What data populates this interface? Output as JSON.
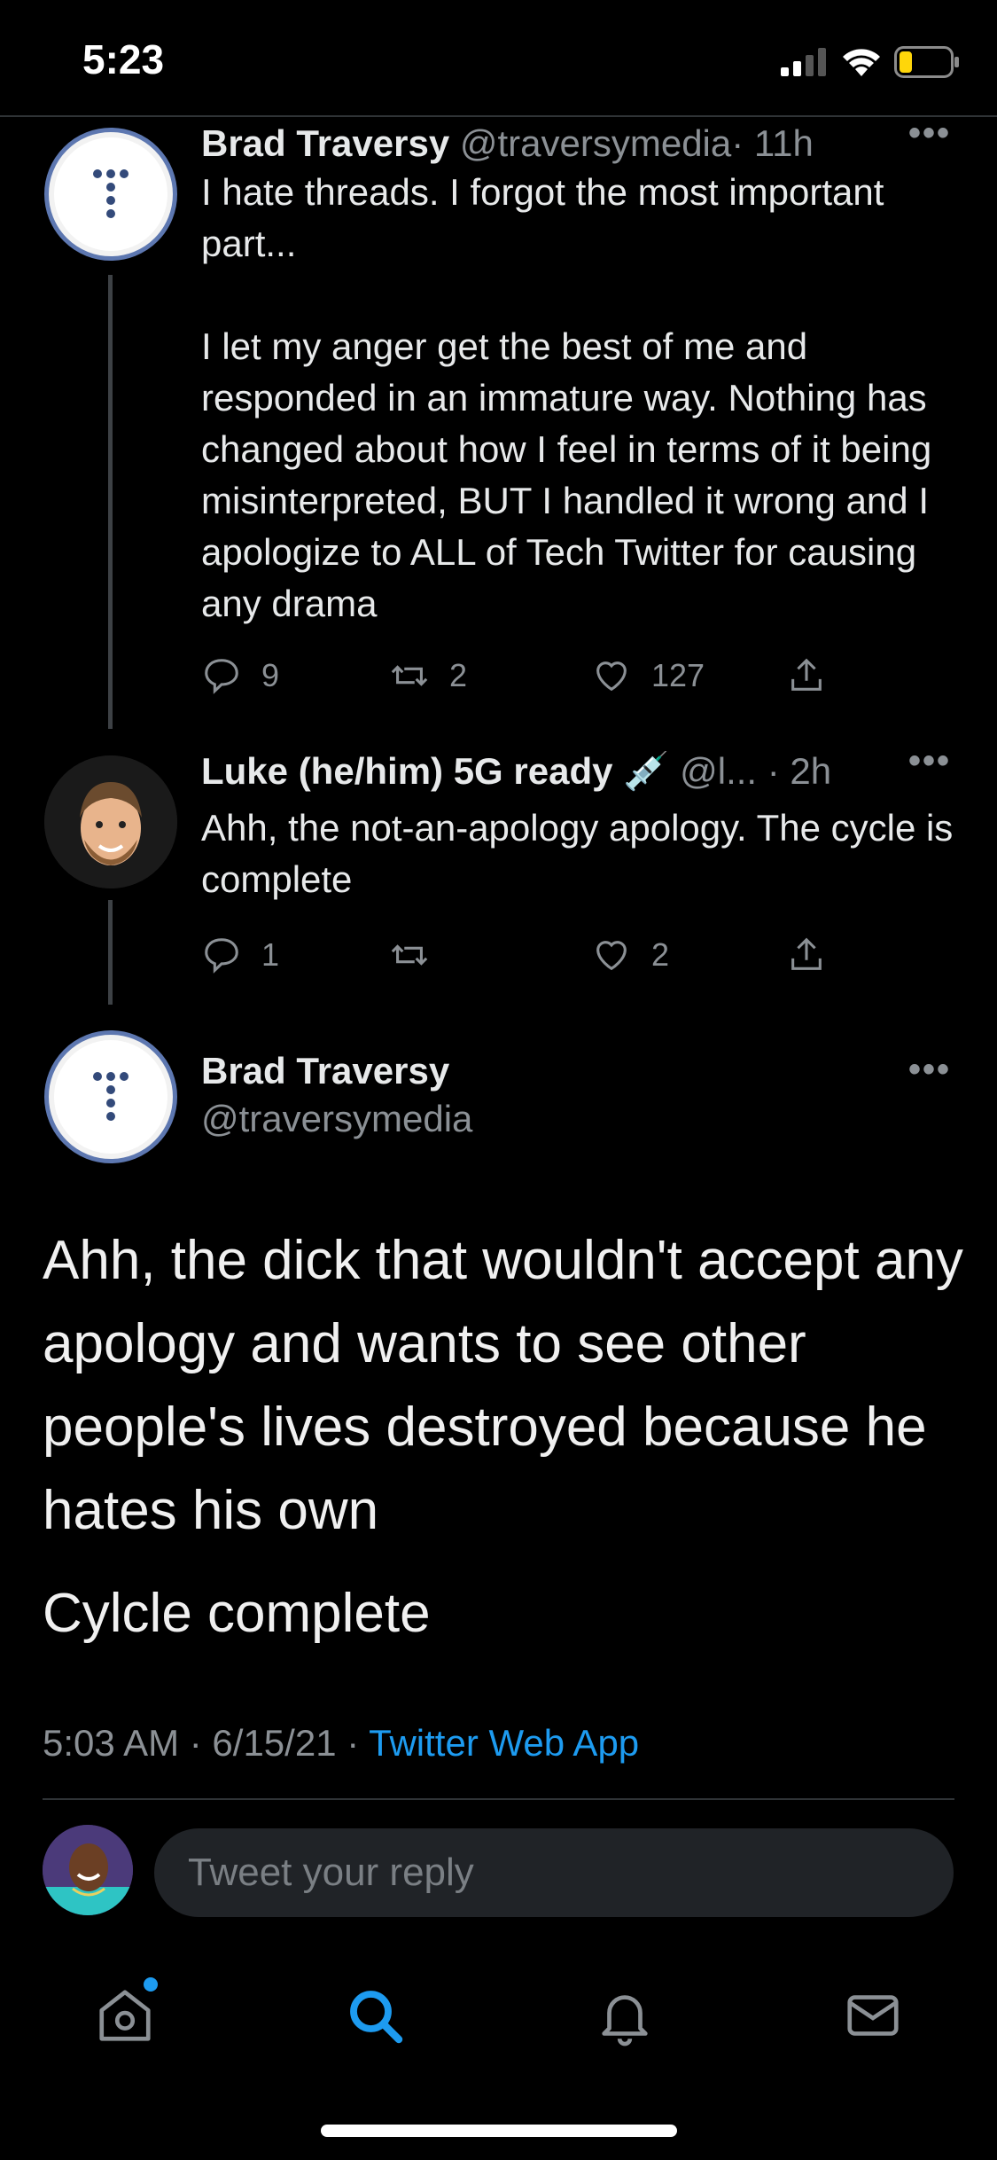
{
  "status_bar": {
    "time": "5:23"
  },
  "tweets": [
    {
      "name": "Brad Traversy",
      "handle": "@traversymedia",
      "time": "· 11h",
      "text": "I hate threads. I forgot the most important part...\n\nI let my anger get the best of me and responded in an immature way. Nothing has changed about how I feel in terms of it being misinterpreted, BUT I handled it wrong and I apologize to ALL of Tech Twitter for causing any drama",
      "replies": "9",
      "retweets": "2",
      "likes": "127"
    },
    {
      "name": "Luke (he/him) 5G ready 💉",
      "handle": "@l...",
      "time": "· 2h",
      "text": "Ahh, the not-an-apology apology. The cycle is complete",
      "replies": "1",
      "retweets": "",
      "likes": "2"
    }
  ],
  "main_tweet": {
    "name": "Brad Traversy",
    "handle": "@traversymedia",
    "text1": "Ahh, the dick that wouldn't accept any apology and wants to see other people's lives destroyed because he hates his own",
    "text2": "Cylcle complete",
    "timestamp": "5:03 AM · 6/15/21 · ",
    "source": "Twitter Web App"
  },
  "reply_box": {
    "placeholder": "Tweet your reply"
  },
  "tabbar": {
    "items": [
      "home-icon",
      "search-icon",
      "notifications-icon",
      "messages-icon"
    ],
    "active": "search-icon"
  },
  "colors": {
    "accent": "#1d9bf0",
    "background": "#000000",
    "secondary_text": "#8b9095"
  }
}
